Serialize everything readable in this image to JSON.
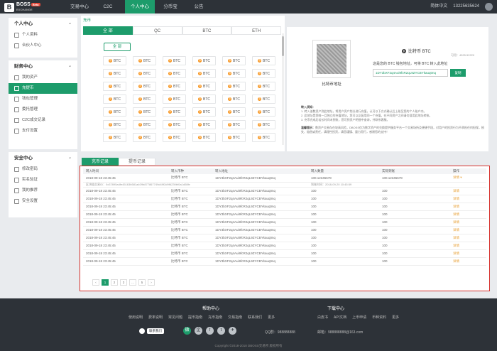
{
  "brand": {
    "mark": "B",
    "name": "BOSS",
    "sub": "EXCHANGE",
    "badge": "Beta"
  },
  "nav": {
    "items": [
      "交易中心",
      "C2C",
      "个人中心",
      "分币宝",
      "公告"
    ],
    "active": 2
  },
  "topright": {
    "language": "简体中文",
    "phone": "13225635624"
  },
  "sidebar": {
    "personal": {
      "title": "个人中心",
      "items": [
        "个人资料",
        "合伙人中心"
      ]
    },
    "finance": {
      "title": "财务中心",
      "items": [
        "我的资产",
        "充提币",
        "钱包管理",
        "委托管理",
        "C2C成交记录",
        "支付设置"
      ],
      "active": 1
    },
    "security": {
      "title": "安全中心",
      "items": [
        "修改密码",
        "实名验证",
        "我的推荐",
        "安全设置"
      ]
    }
  },
  "crumb": "充币",
  "coin_tabs": [
    "全 部",
    "QC",
    "BTC",
    "ETH"
  ],
  "all_button": "全 部",
  "coin_label": "BTC",
  "deposit": {
    "qr_label": "比特币地址",
    "coin_name": "比特币 BTC",
    "balance": "可用：4525.52220",
    "description": "这是您的 BTC 钱包地址，可将 BTC 转入此地址",
    "address": "1DY3bXF2q4Aui9fcR2qL9ZYCBYkauqtmq",
    "copy": "复制",
    "notes_title": "转入须知：",
    "notes": [
      "1. 转入该数资产到此地址，将用户资产划分进行充值，认可以下方式确认后上账至您的个人账户内。",
      "2. 此地址是您唯一且独立的充值地址，您可以反复用同一个充值，在不同资产之间请勿混用此地址转账。",
      "3. 充币完成后若长时间未到账，您可到资产明细中查询，并联系客服。"
    ],
    "warn_title": "温馨提示：",
    "warn": "数资产交易存在较高风险，DBOSS仅为数字资产的兑换提供服务平台一个交易场所及便捷手段，对用户的投资行为不承担任何担保，损失、赔偿或责任，请理性投资，请您谨慎、量力而行，感谢您的支持！"
  },
  "records": {
    "tabs": [
      "充币记录",
      "提币记录"
    ],
    "columns": [
      "转入时间",
      "转入币种",
      "转入地址",
      "转入数量",
      "实际到账",
      "操作"
    ],
    "rows": [
      {
        "time": "2018-09-18 23:45:45",
        "coin": "比特币 BTC",
        "addr": "1DY3bXF2q4Aui9fcR2qL9ZYCBYkauqtmq",
        "amount": "100.12345678",
        "actual": "100.12345678",
        "op": "详情 ▾"
      },
      {
        "time": "2018-09-18 23:45:45",
        "coin": "比特币 BTC",
        "addr": "1DY3bXF2q4Aui9fcR2qL9ZYCBYkauqtmq",
        "amount": "100",
        "actual": "100",
        "op": "详情"
      },
      {
        "time": "2018-09-18 23:45:45",
        "coin": "比特币 BTC",
        "addr": "1DY3bXF2q4Aui9fcR2qL9ZYCBYkauqtmq",
        "amount": "100",
        "actual": "100",
        "op": "详情"
      },
      {
        "time": "2018-09-18 23:45:45",
        "coin": "比特币 BTC",
        "addr": "1DY3bXF2q4Aui9fcR2qL9ZYCBYkauqtmq",
        "amount": "100",
        "actual": "100",
        "op": "详情"
      },
      {
        "time": "2018-09-18 23:45:45",
        "coin": "比特币 BTC",
        "addr": "1DY3bXF2q4Aui9fcR2qL9ZYCBYkauqtmq",
        "amount": "100",
        "actual": "100",
        "op": "详情"
      },
      {
        "time": "2018-09-18 23:45:45",
        "coin": "比特币 BTC",
        "addr": "1DY3bXF2q4Aui9fcR2qL9ZYCBYkauqtmq",
        "amount": "100",
        "actual": "100",
        "op": "详情"
      },
      {
        "time": "2018-09-18 23:45:45",
        "coin": "比特币 BTC",
        "addr": "1DY3bXF2q4Aui9fcR2qL9ZYCBYkauqtmq",
        "amount": "100",
        "actual": "100",
        "op": "详情"
      },
      {
        "time": "2018-09-18 23:45:45",
        "coin": "比特币 BTC",
        "addr": "1DY3bXF2q4Aui9fcR2qL9ZYCBYkauqtmq",
        "amount": "100",
        "actual": "100",
        "op": "详情"
      },
      {
        "time": "2018-09-18 23:45:45",
        "coin": "比特币 BTC",
        "addr": "1DY3bXF2q4Aui9fcR2qL9ZYCBYkauqtmq",
        "amount": "100",
        "actual": "100",
        "op": "详情"
      },
      {
        "time": "2018-09-18 23:45:45",
        "coin": "比特币 BTC",
        "addr": "1DY3bXF2q4Aui9fcR2qL9ZYCBYkauqtmq",
        "amount": "100",
        "actual": "100",
        "op": "详情"
      },
      {
        "time": "2018-09-18 23:45:45",
        "coin": "比特币 BTC",
        "addr": "1DY3bXF2q4Aui9fcR2qL9ZYCBYkauqtmq",
        "amount": "100",
        "actual": "100",
        "op": "详情"
      }
    ],
    "detail": {
      "txid": "区块链交易ID：0x37895a4fe45163b581a409b877867749d49f2d9f6239bf0a1d08fe",
      "confirm": "到账时间：2018-09-20 10:45:59"
    },
    "pager": [
      "‹",
      "1",
      "2",
      "3",
      "...",
      "5",
      "›"
    ],
    "current_page": "1"
  },
  "footer": {
    "help_title": "帮助中心",
    "help_links": [
      "使用说明",
      "费率说明",
      "常见问题",
      "联系我们",
      "更多"
    ],
    "left_links": [
      "提币指南",
      "充币指南",
      "交易指南"
    ],
    "download_title": "下载中心",
    "download_links": [
      "白皮书",
      "API文档",
      "上币申请",
      "币种资料",
      "更多"
    ],
    "logo_text": "联系我们",
    "social": [
      "微",
      "企",
      "f",
      "t",
      "✈"
    ],
    "qq": "QQ群：988888888",
    "email": "邮箱：988888888@163.com",
    "copyright": "Copyright ©2018-2018 DBOSS交易所 版权所有"
  }
}
